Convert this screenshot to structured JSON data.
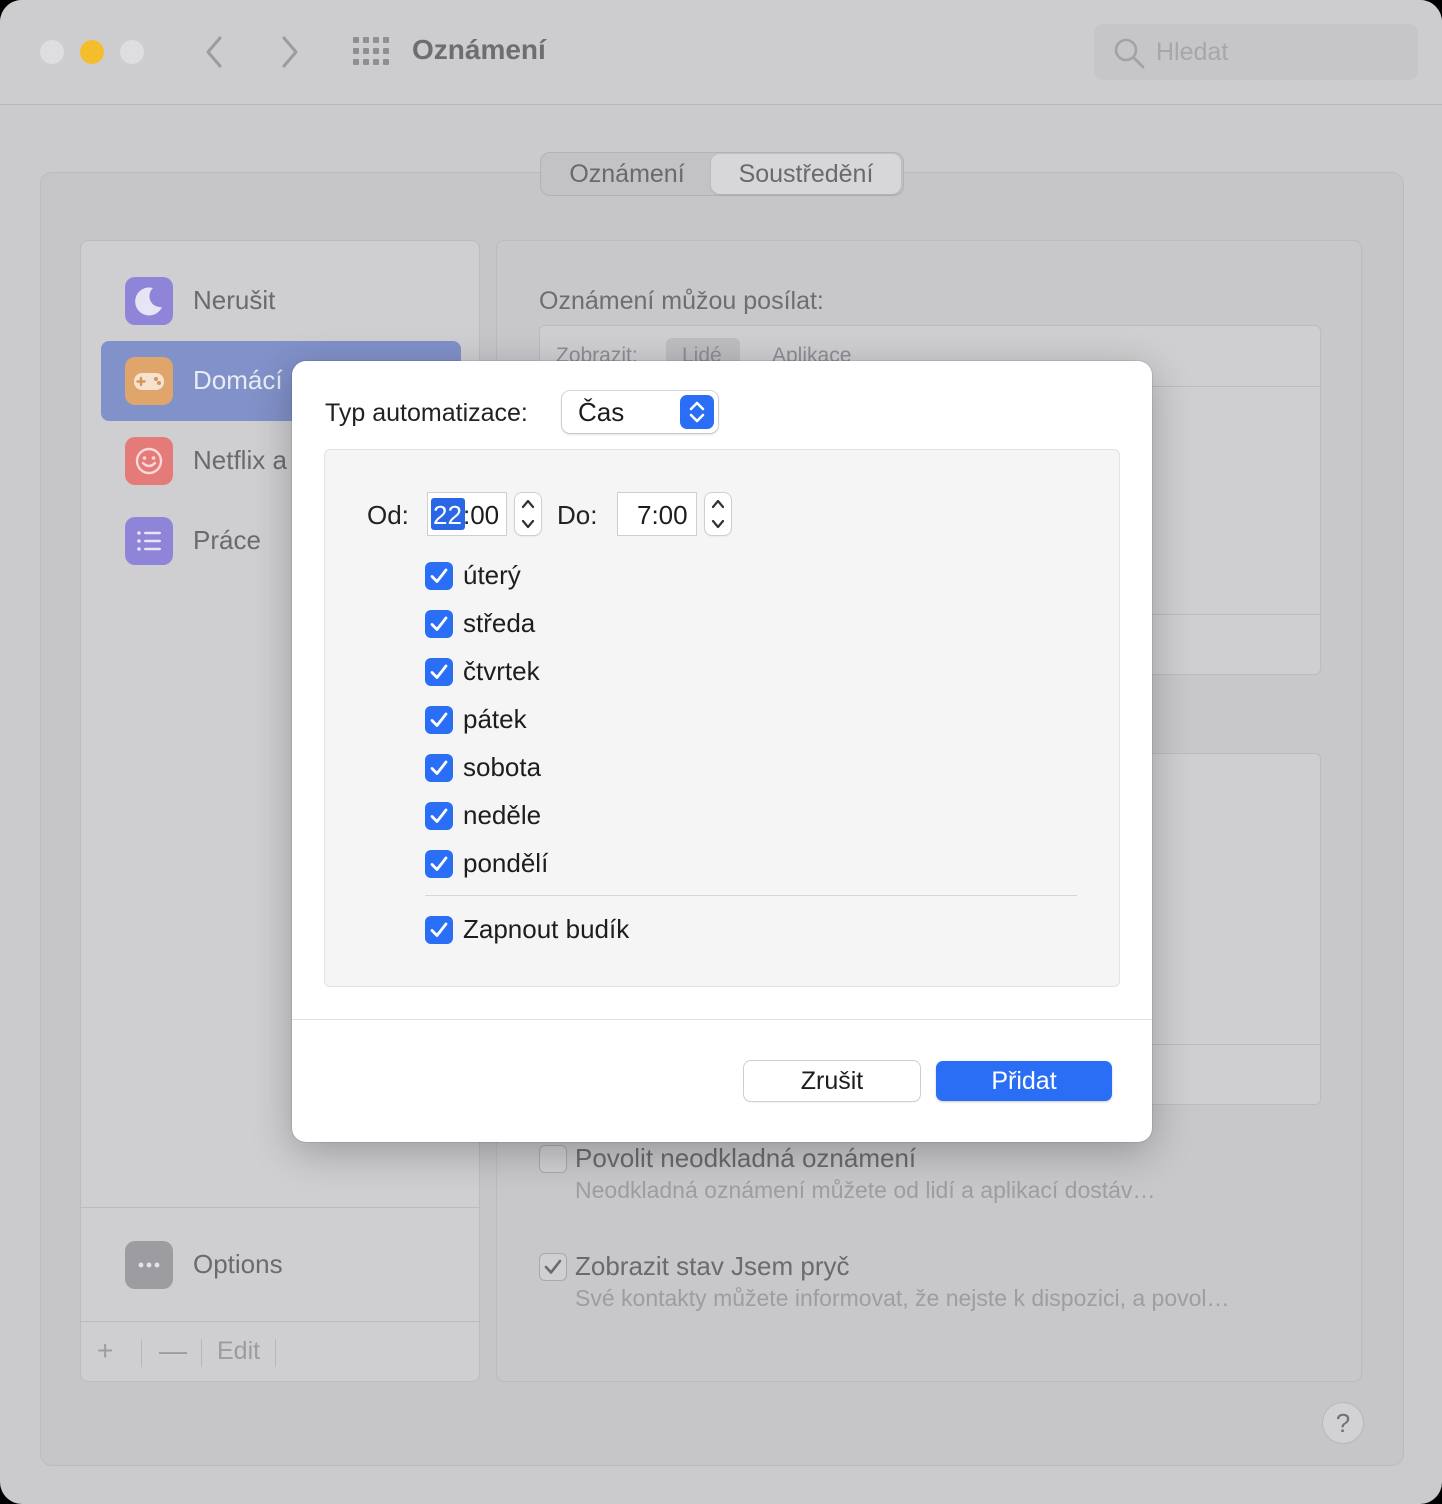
{
  "window": {
    "title": "Oznámení"
  },
  "search": {
    "placeholder": "Hledat"
  },
  "segmented": {
    "items": [
      "Oznámení",
      "Soustředění"
    ],
    "selected": "Soustředění"
  },
  "sidebar": {
    "items": [
      {
        "label": "Nerušit",
        "icon": "moon-icon",
        "color": "#8e84d8"
      },
      {
        "label": "Domácí",
        "icon": "gamepad-icon",
        "color": "#e0a56a",
        "selected": true
      },
      {
        "label": "Netflix a",
        "icon": "smiley-icon",
        "color": "#e57b78"
      },
      {
        "label": "Práce",
        "icon": "list-icon",
        "color": "#8e84d8"
      }
    ],
    "options": {
      "label": "Options",
      "icon": "ellipsis-icon"
    },
    "toolbar": {
      "add": "+",
      "remove": "—",
      "edit": "Edit"
    }
  },
  "right_panel": {
    "heading": "Oznámení můžou posílat:",
    "tabs": {
      "show_label": "Zobrazit:",
      "people": "Lidé",
      "apps": "Aplikace"
    },
    "options": [
      {
        "title": "Povolit neodkladná oznámení",
        "description": "Neodkladná oznámení můžete od lidí a aplikací dostáv…",
        "checked": false
      },
      {
        "title": "Zobrazit stav Jsem pryč",
        "description": "Své kontakty můžete informovat, že nejste k dispozici, a povol…",
        "checked": true
      }
    ],
    "help": "?"
  },
  "modal": {
    "type_label": "Typ automatizace:",
    "type_value": "Čas",
    "from_label": "Od:",
    "from_hour": "22",
    "from_rest": ":00",
    "to_label": "Do:",
    "to_value": "7:00",
    "days": [
      {
        "label": "úterý",
        "checked": true
      },
      {
        "label": "středa",
        "checked": true
      },
      {
        "label": "čtvrtek",
        "checked": true
      },
      {
        "label": "pátek",
        "checked": true
      },
      {
        "label": "sobota",
        "checked": true
      },
      {
        "label": "neděle",
        "checked": true
      },
      {
        "label": "pondělí",
        "checked": true
      }
    ],
    "alarm": {
      "label": "Zapnout budík",
      "checked": true
    },
    "cancel_label": "Zrušit",
    "add_label": "Přidat"
  },
  "colors": {
    "accent": "#2a6ef5",
    "selection": "#8191c9"
  }
}
